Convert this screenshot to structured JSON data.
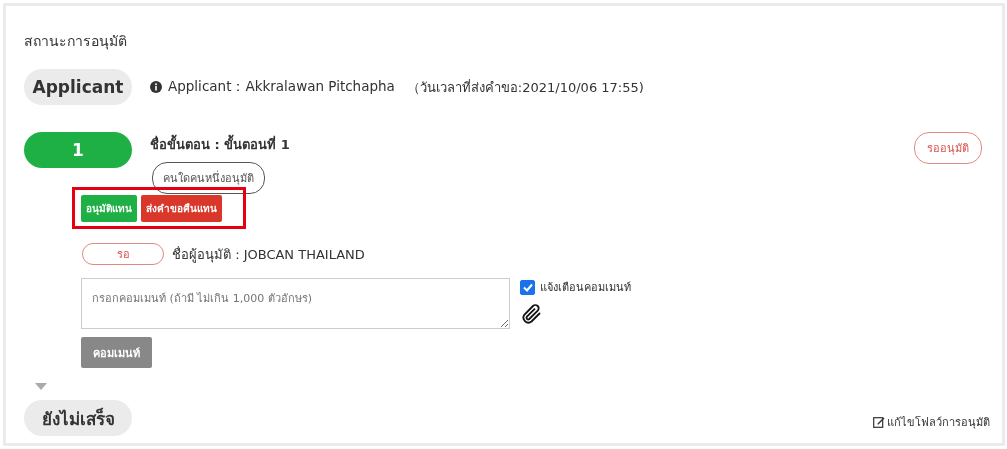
{
  "title": "สถานะการอนุมัติ",
  "applicant": {
    "badge": "Applicant",
    "info": "Applicant：Akkralawan Pitchapha",
    "sent_time": "（วันเวลาที่ส่งคำขอ:2021/10/06 17:55)"
  },
  "step": {
    "number": "1",
    "name": "ชื่อขั้นตอน : ขั้นตอนที่ 1",
    "status": "รออนุมัติ",
    "rule": "คนใดคนหนึ่งอนุมัติ",
    "actions": [
      {
        "label": "อนุมัติแทน",
        "kind": "approve"
      },
      {
        "label": "ส่งคำขอคืนแทน",
        "kind": "return"
      }
    ],
    "approver": {
      "status": "รอ",
      "name": "ชื่อผู้อนุมัติ : JOBCAN THAILAND"
    },
    "comment": {
      "placeholder": "กรอกคอมเมนท์ (ถ้ามี ไม่เกิน 1,000 ตัวอักษร)",
      "notify_label": "แจ้งเตือนคอมเมนท์",
      "notify_checked": true,
      "button": "คอมเมนท์"
    }
  },
  "pending": "ยังไม่เสร็จ",
  "edit_link": "แก้ไขโฟลว์การอนุมัติ"
}
